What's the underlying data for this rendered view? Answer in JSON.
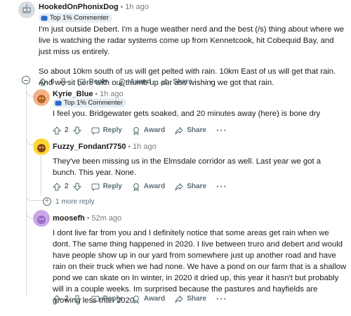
{
  "comments": [
    {
      "username": "HookedOnPhonixDog",
      "time": "1h ago",
      "flair": "Top 1% Commenter",
      "paragraphs": [
        "I'm just outside Debert. I'm a huge weather nerd and the best (/s) thing about where we live is watching the radar systems come up from Kennetcook, hit Cobequid Bay, and just miss us entirely.",
        "So about 10km south of us will get pelted with rain. 10km East of us will get that rain. And we sit here with our thumb up our ass wishing we got that rain."
      ],
      "votes": "6"
    },
    {
      "username": "Kyrie_Blue",
      "time": "1h ago",
      "flair": "Top 1% Commenter",
      "paragraphs": [
        "I feel you. Bridgewater gets soaked, and 20 minutes away (here) is bone dry"
      ],
      "votes": "2"
    },
    {
      "username": "Fuzzy_Fondant7750",
      "time": "1h ago",
      "paragraphs": [
        "They've been missing us in the Elmsdale corridor as well. Last year we got a bunch. This year. None."
      ],
      "votes": "2"
    },
    {
      "username": "moosefh",
      "time": "52m ago",
      "paragraphs": [
        "I dont live far from you and I definitely notice that some areas get rain when we dont. The same thing happened in 2020. I live between truro and debert and would have people show up in our yard from somewhere just up another road and have rain on their truck when we had none. We have a pond on our farm that is a shallow pond we can skate on In winter, in 2020 it dried up, this year it hasn't but probably will in a couple weeks. Im surprised because the pastures and hayfields are growing less than 2020."
      ],
      "votes": "2"
    }
  ],
  "labels": {
    "reply": "Reply",
    "award": "Award",
    "share": "Share",
    "more": "···",
    "separator": "•",
    "more_replies": "1 more reply"
  },
  "colors": {
    "meta": "#576f76",
    "thread": "#d3d6da",
    "flair_bg": "#e6edf3"
  }
}
